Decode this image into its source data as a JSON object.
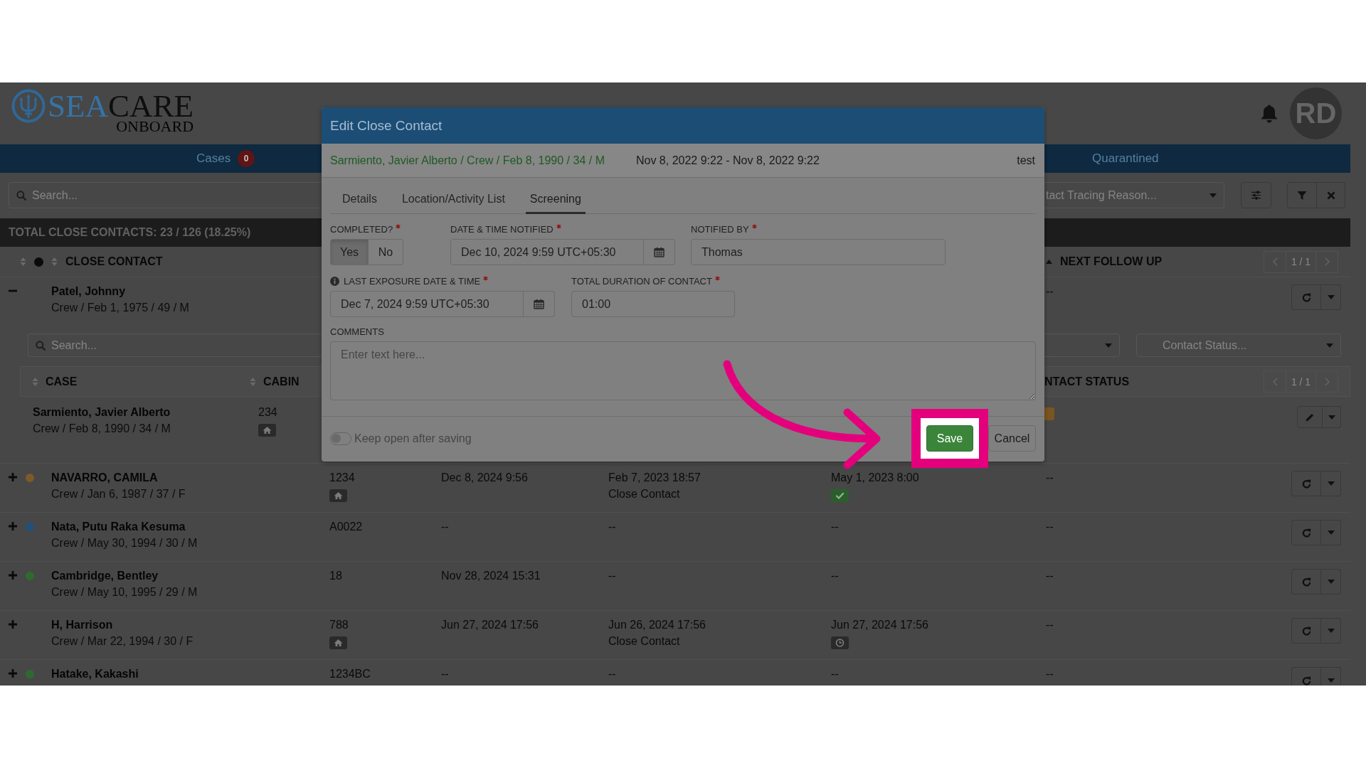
{
  "header": {
    "logo": {
      "brand_primary": "SEA",
      "brand_secondary": "CARE",
      "tagline": "ONBOARD"
    },
    "avatar_initials": "RD"
  },
  "nav_tabs": [
    {
      "label": "Cases",
      "count": "0"
    },
    {
      "label": "Quarantined"
    }
  ],
  "toolbar": {
    "search_placeholder": "Search...",
    "reason_filter_placeholder": "tact Tracing Reason..."
  },
  "summary": "TOTAL CLOSE CONTACTS: 23 / 126 (18.25%)",
  "case_list": {
    "columns": {
      "close_contact": "CLOSE CONTACT",
      "next_follow_up": "NEXT FOLLOW UP"
    },
    "pagination": "1 / 1",
    "rows": [
      {
        "name": "Patel, Johnny",
        "details": "Crew / Feb 1, 1975 / 49 / M",
        "expanded": true,
        "next_follow_up": "--",
        "close_contacts": {
          "search_placeholder": "Search...",
          "status_filter_placeholder": "Contact Status...",
          "columns": {
            "case": "CASE",
            "cabin": "CABIN",
            "column_3": "NTACT STATUS"
          },
          "pagination": "1 / 1",
          "rows": [
            {
              "name": "Sarmiento, Javier Alberto",
              "details": "Crew / Feb 8, 1990 / 34 / M",
              "cabin": {
                "kind": "home",
                "text": "234"
              }
            }
          ]
        }
      },
      {
        "name": "NAVARRO, CAMILA",
        "details": "Crew / Jan 6, 1987 / 37 / F",
        "color": "#7d5a28",
        "expanded": false,
        "cells": [
          {
            "kind": "home",
            "text": "1234"
          },
          {
            "kind": "text",
            "text": "Dec 8, 2024 9:56"
          },
          {
            "kind": "text",
            "text": "Feb 7, 2023 18:57",
            "note": "Close Contact"
          },
          {
            "kind": "check",
            "text": "May 1, 2023 8:00"
          }
        ],
        "next_follow_up": "--"
      },
      {
        "name": "Nata, Putu Raka Kesuma",
        "details": "Crew / May 30, 1994 / 30 / M",
        "color": "#22507c",
        "expanded": false,
        "cells": [
          {
            "kind": "text",
            "text": "A0022"
          },
          {
            "kind": "text",
            "text": "--"
          },
          {
            "kind": "text",
            "text": "--"
          },
          {
            "kind": "text",
            "text": "--"
          }
        ],
        "next_follow_up": "--"
      },
      {
        "name": "Cambridge, Bentley",
        "details": "Crew / May 10, 1995 / 29 / M",
        "color": "#2e6a30",
        "expanded": false,
        "cells": [
          {
            "kind": "text",
            "text": "18"
          },
          {
            "kind": "text",
            "text": "Nov 28, 2024 15:31"
          },
          {
            "kind": "text",
            "text": "--"
          },
          {
            "kind": "text",
            "text": "--"
          }
        ],
        "next_follow_up": "--"
      },
      {
        "name": "H, Harrison",
        "details": "Crew / Mar 22, 1994 / 30 / F",
        "expanded": false,
        "cells": [
          {
            "kind": "home",
            "text": "788"
          },
          {
            "kind": "text",
            "text": "Jun 27, 2024 17:56"
          },
          {
            "kind": "text",
            "text": "Jun 26, 2024 17:56",
            "note": "Close Contact"
          },
          {
            "kind": "clock",
            "text": "Jun 27, 2024 17:56"
          }
        ],
        "next_follow_up": "--"
      },
      {
        "name": "Hatake, Kakashi",
        "color": "#2e6a30",
        "expanded": false,
        "cells": [
          {
            "kind": "text",
            "text": "1234BC"
          },
          {
            "kind": "text",
            "text": "--"
          },
          {
            "kind": "text",
            "text": "--"
          },
          {
            "kind": "text",
            "text": "--"
          }
        ],
        "next_follow_up": "--"
      }
    ]
  },
  "modal": {
    "title": "Edit Close Contact",
    "subject": "Sarmiento, Javier Alberto / Crew / Feb 8, 1990 / 34 / M",
    "period": "Nov 8, 2022 9:22 - Nov 8, 2022 9:22",
    "tag": "test",
    "tabs": [
      {
        "label": "Details",
        "selected": false
      },
      {
        "label": "Location/Activity List",
        "selected": false
      },
      {
        "label": "Screening",
        "selected": true
      }
    ],
    "completed": {
      "label": "COMPLETED?",
      "required": true,
      "options": [
        {
          "label": "Yes",
          "selected": true
        },
        {
          "label": "No",
          "selected": false
        }
      ]
    },
    "date_notified": {
      "label": "DATE & TIME NOTIFIED",
      "required": true,
      "value": "Dec 10, 2024 9:59 UTC+05:30"
    },
    "notified_by": {
      "label": "NOTIFIED BY",
      "required": true,
      "value": "Thomas"
    },
    "last_exposure": {
      "label": "LAST EXPOSURE DATE & TIME",
      "required": true,
      "info": true,
      "value": "Dec 7, 2024 9:59 UTC+05:30"
    },
    "duration": {
      "label": "TOTAL DURATION OF CONTACT",
      "required": true,
      "value": "01:00"
    },
    "comments": {
      "label": "COMMENTS",
      "placeholder": "Enter text here..."
    },
    "keep_open": {
      "label": "Keep open after saving",
      "on": false
    },
    "buttons": [
      {
        "label": "Save",
        "kind": "primary",
        "highlighted": true
      },
      {
        "label": "Cancel",
        "kind": "default",
        "highlighted": false
      }
    ]
  }
}
